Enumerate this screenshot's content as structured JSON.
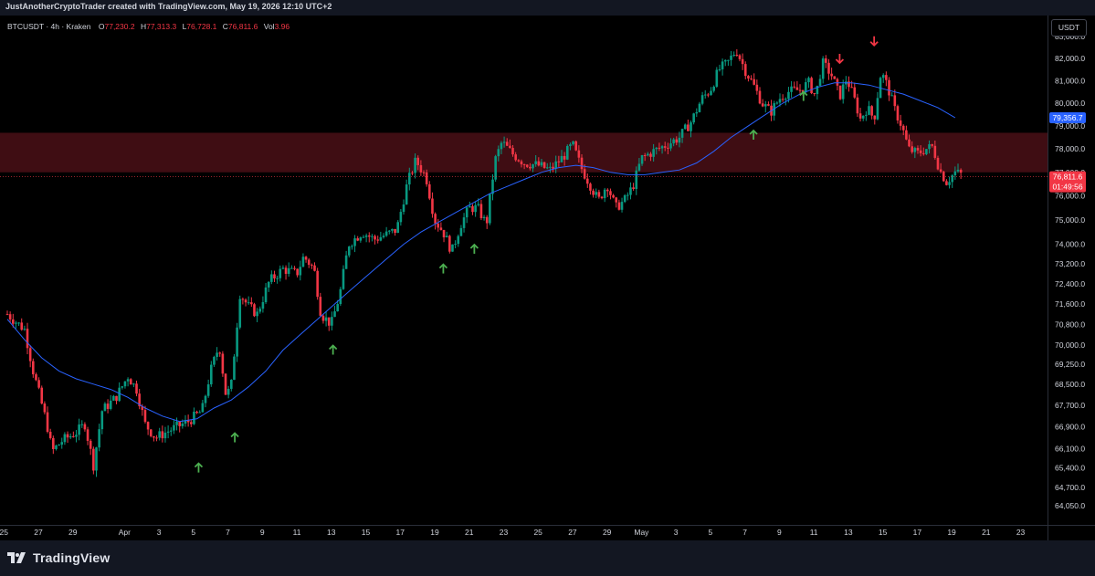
{
  "header": {
    "caption": "JustAnotherCryptoTrader created with TradingView.com, May 19, 2026 12:10 UTC+2"
  },
  "legend": {
    "symbol": "BTCUSDT · 4h · Kraken",
    "o_label": "O",
    "o_value": "77,230.2",
    "h_label": "H",
    "h_value": "77,313.3",
    "l_label": "L",
    "l_value": "76,728.1",
    "c_label": "C",
    "c_value": "76,811.6",
    "vol_label": "Vol",
    "vol_value": "3.96"
  },
  "currency_button": "USDT",
  "branding": "TradingView",
  "colors": {
    "up": "#089981",
    "down": "#f23645",
    "ma": "#2962ff",
    "zone": "#4a0f16",
    "up_arrow": "#4caf50",
    "down_arrow": "#f23645",
    "axis_text": "#d1d4dc"
  },
  "chart_data": {
    "type": "line",
    "chart_style": "candlestick",
    "title": "",
    "xlabel": "",
    "ylabel": "",
    "scale": "log",
    "ylim": [
      63600,
      83400
    ],
    "y_ticks": [
      {
        "label": "83,000.0",
        "value": 83000
      },
      {
        "label": "82,000.0",
        "value": 82000
      },
      {
        "label": "81,000.0",
        "value": 81000
      },
      {
        "label": "80,000.0",
        "value": 80000
      },
      {
        "label": "79,000.0",
        "value": 79000
      },
      {
        "label": "78,000.0",
        "value": 78000
      },
      {
        "label": "77,000.0",
        "value": 77000
      },
      {
        "label": "76,000.0",
        "value": 76000
      },
      {
        "label": "75,000.0",
        "value": 75000
      },
      {
        "label": "74,000.0",
        "value": 74000
      },
      {
        "label": "73,200.0",
        "value": 73200
      },
      {
        "label": "72,400.0",
        "value": 72400
      },
      {
        "label": "71,600.0",
        "value": 71600
      },
      {
        "label": "70,800.0",
        "value": 70800
      },
      {
        "label": "70,000.0",
        "value": 70000
      },
      {
        "label": "69,250.0",
        "value": 69250
      },
      {
        "label": "68,500.0",
        "value": 68500
      },
      {
        "label": "67,700.0",
        "value": 67700
      },
      {
        "label": "66,900.0",
        "value": 66900
      },
      {
        "label": "66,100.0",
        "value": 66100
      },
      {
        "label": "65,400.0",
        "value": 65400
      },
      {
        "label": "64,700.0",
        "value": 64700
      },
      {
        "label": "64,050.0",
        "value": 64050
      }
    ],
    "x_ticks": [
      {
        "label": "25",
        "day": -0.2
      },
      {
        "label": "27",
        "day": 1.8
      },
      {
        "label": "29",
        "day": 3.8
      },
      {
        "label": "Apr",
        "day": 6.8
      },
      {
        "label": "3",
        "day": 8.8
      },
      {
        "label": "5",
        "day": 10.8
      },
      {
        "label": "7",
        "day": 12.8
      },
      {
        "label": "9",
        "day": 14.8
      },
      {
        "label": "11",
        "day": 16.8
      },
      {
        "label": "13",
        "day": 18.8
      },
      {
        "label": "15",
        "day": 20.8
      },
      {
        "label": "17",
        "day": 22.8
      },
      {
        "label": "19",
        "day": 24.8
      },
      {
        "label": "21",
        "day": 26.8
      },
      {
        "label": "23",
        "day": 28.8
      },
      {
        "label": "25",
        "day": 30.8
      },
      {
        "label": "27",
        "day": 32.8
      },
      {
        "label": "29",
        "day": 34.8
      },
      {
        "label": "May",
        "day": 36.8
      },
      {
        "label": "3",
        "day": 38.8
      },
      {
        "label": "5",
        "day": 40.8
      },
      {
        "label": "7",
        "day": 42.8
      },
      {
        "label": "9",
        "day": 44.8
      },
      {
        "label": "11",
        "day": 46.8
      },
      {
        "label": "13",
        "day": 48.8
      },
      {
        "label": "15",
        "day": 50.8
      },
      {
        "label": "17",
        "day": 52.8
      },
      {
        "label": "19",
        "day": 54.8
      },
      {
        "label": "21",
        "day": 56.8
      },
      {
        "label": "23",
        "day": 58.8
      }
    ],
    "price_key_points": [
      [
        0,
        71200
      ],
      [
        1,
        70600
      ],
      [
        1.5,
        69000
      ],
      [
        2.3,
        67000
      ],
      [
        2.6,
        66000
      ],
      [
        3.2,
        66400
      ],
      [
        4,
        66700
      ],
      [
        4.5,
        67000
      ],
      [
        5,
        65500
      ],
      [
        5.5,
        67500
      ],
      [
        6.3,
        68000
      ],
      [
        7,
        68800
      ],
      [
        7.5,
        68300
      ],
      [
        8,
        67000
      ],
      [
        8.6,
        66500
      ],
      [
        9.5,
        66800
      ],
      [
        10.5,
        67100
      ],
      [
        11.3,
        67500
      ],
      [
        11.8,
        69000
      ],
      [
        12.3,
        70000
      ],
      [
        12.7,
        68000
      ],
      [
        13,
        68500
      ],
      [
        13.5,
        72000
      ],
      [
        14,
        71500
      ],
      [
        14.5,
        71200
      ],
      [
        15.2,
        72500
      ],
      [
        16,
        73000
      ],
      [
        16.8,
        72800
      ],
      [
        17.2,
        73500
      ],
      [
        17.8,
        73000
      ],
      [
        18.2,
        71200
      ],
      [
        18.8,
        70800
      ],
      [
        19.3,
        72000
      ],
      [
        19.8,
        74000
      ],
      [
        20.6,
        74500
      ],
      [
        21.3,
        74200
      ],
      [
        22,
        74400
      ],
      [
        22.6,
        74600
      ],
      [
        23.2,
        76500
      ],
      [
        23.7,
        77500
      ],
      [
        24.3,
        76800
      ],
      [
        24.8,
        75000
      ],
      [
        25.3,
        74500
      ],
      [
        25.8,
        73700
      ],
      [
        26.3,
        74800
      ],
      [
        26.8,
        75500
      ],
      [
        27.3,
        75500
      ],
      [
        27.8,
        74800
      ],
      [
        28.3,
        77500
      ],
      [
        28.7,
        78300
      ],
      [
        29.3,
        77800
      ],
      [
        30,
        77400
      ],
      [
        30.8,
        77300
      ],
      [
        31.5,
        77100
      ],
      [
        32.3,
        77700
      ],
      [
        32.8,
        78200
      ],
      [
        33.3,
        77200
      ],
      [
        33.8,
        76500
      ],
      [
        34.3,
        75800
      ],
      [
        34.8,
        76500
      ],
      [
        35.3,
        75500
      ],
      [
        35.8,
        75800
      ],
      [
        36.3,
        76400
      ],
      [
        36.8,
        77600
      ],
      [
        37.5,
        77900
      ],
      [
        38.3,
        78200
      ],
      [
        39,
        78500
      ],
      [
        39.7,
        79200
      ],
      [
        40.3,
        80200
      ],
      [
        40.8,
        80600
      ],
      [
        41.3,
        81500
      ],
      [
        41.8,
        81800
      ],
      [
        42.3,
        82400
      ],
      [
        42.8,
        81500
      ],
      [
        43.3,
        80800
      ],
      [
        43.8,
        80000
      ],
      [
        44.3,
        79600
      ],
      [
        44.8,
        80200
      ],
      [
        45.3,
        80500
      ],
      [
        46,
        80600
      ],
      [
        46.5,
        80900
      ],
      [
        46.9,
        80300
      ],
      [
        47.3,
        81800
      ],
      [
        47.8,
        81300
      ],
      [
        48.3,
        80300
      ],
      [
        48.7,
        81100
      ],
      [
        49.1,
        80300
      ],
      [
        49.5,
        79300
      ],
      [
        49.9,
        79800
      ],
      [
        50.3,
        79300
      ],
      [
        50.7,
        81400
      ],
      [
        51.1,
        80700
      ],
      [
        51.5,
        79700
      ],
      [
        51.9,
        79000
      ],
      [
        52.3,
        78000
      ],
      [
        52.8,
        77800
      ],
      [
        53.3,
        78000
      ],
      [
        53.7,
        78100
      ],
      [
        54.1,
        77100
      ],
      [
        54.5,
        76600
      ],
      [
        55,
        77000
      ],
      [
        55.4,
        76900
      ]
    ],
    "moving_average": [
      [
        0,
        71000
      ],
      [
        1,
        70200
      ],
      [
        2,
        69500
      ],
      [
        3,
        69000
      ],
      [
        4,
        68700
      ],
      [
        5,
        68500
      ],
      [
        6,
        68300
      ],
      [
        7,
        68000
      ],
      [
        8,
        67600
      ],
      [
        9,
        67300
      ],
      [
        10,
        67100
      ],
      [
        11,
        67200
      ],
      [
        12,
        67600
      ],
      [
        13,
        67900
      ],
      [
        14,
        68400
      ],
      [
        15,
        69000
      ],
      [
        16,
        69800
      ],
      [
        17,
        70400
      ],
      [
        18,
        71000
      ],
      [
        19,
        71600
      ],
      [
        20,
        72200
      ],
      [
        21,
        72800
      ],
      [
        22,
        73400
      ],
      [
        23,
        74000
      ],
      [
        24,
        74500
      ],
      [
        25,
        74900
      ],
      [
        26,
        75300
      ],
      [
        27,
        75700
      ],
      [
        28,
        76100
      ],
      [
        29,
        76400
      ],
      [
        30,
        76700
      ],
      [
        31,
        77000
      ],
      [
        32,
        77200
      ],
      [
        33,
        77300
      ],
      [
        34,
        77200
      ],
      [
        35,
        77000
      ],
      [
        36,
        76900
      ],
      [
        37,
        76900
      ],
      [
        38,
        77000
      ],
      [
        39,
        77100
      ],
      [
        40,
        77400
      ],
      [
        41,
        77900
      ],
      [
        42,
        78500
      ],
      [
        43,
        79000
      ],
      [
        44,
        79500
      ],
      [
        45,
        80000
      ],
      [
        46,
        80400
      ],
      [
        47,
        80700
      ],
      [
        48,
        80900
      ],
      [
        49,
        80900
      ],
      [
        50,
        80800
      ],
      [
        51,
        80600
      ],
      [
        52,
        80400
      ],
      [
        53,
        80100
      ],
      [
        54,
        79800
      ],
      [
        55,
        79356.7
      ]
    ],
    "zone": {
      "low": 77000,
      "high": 78700
    },
    "up_arrows": [
      {
        "day": 11.1,
        "price": 65400
      },
      {
        "day": 13.2,
        "price": 66500
      },
      {
        "day": 18.9,
        "price": 69800
      },
      {
        "day": 25.3,
        "price": 73000
      },
      {
        "day": 27.1,
        "price": 73800
      },
      {
        "day": 43.3,
        "price": 78600
      },
      {
        "day": 46.2,
        "price": 80300
      }
    ],
    "down_arrows": [
      {
        "day": 48.3,
        "price": 82000
      },
      {
        "day": 50.3,
        "price": 82800
      }
    ],
    "ma_label": "79,356.7",
    "ma_value": 79356.7,
    "last_price_label": "76,811.6",
    "last_price_value": 76811.6,
    "countdown_label": "01:49:56"
  }
}
